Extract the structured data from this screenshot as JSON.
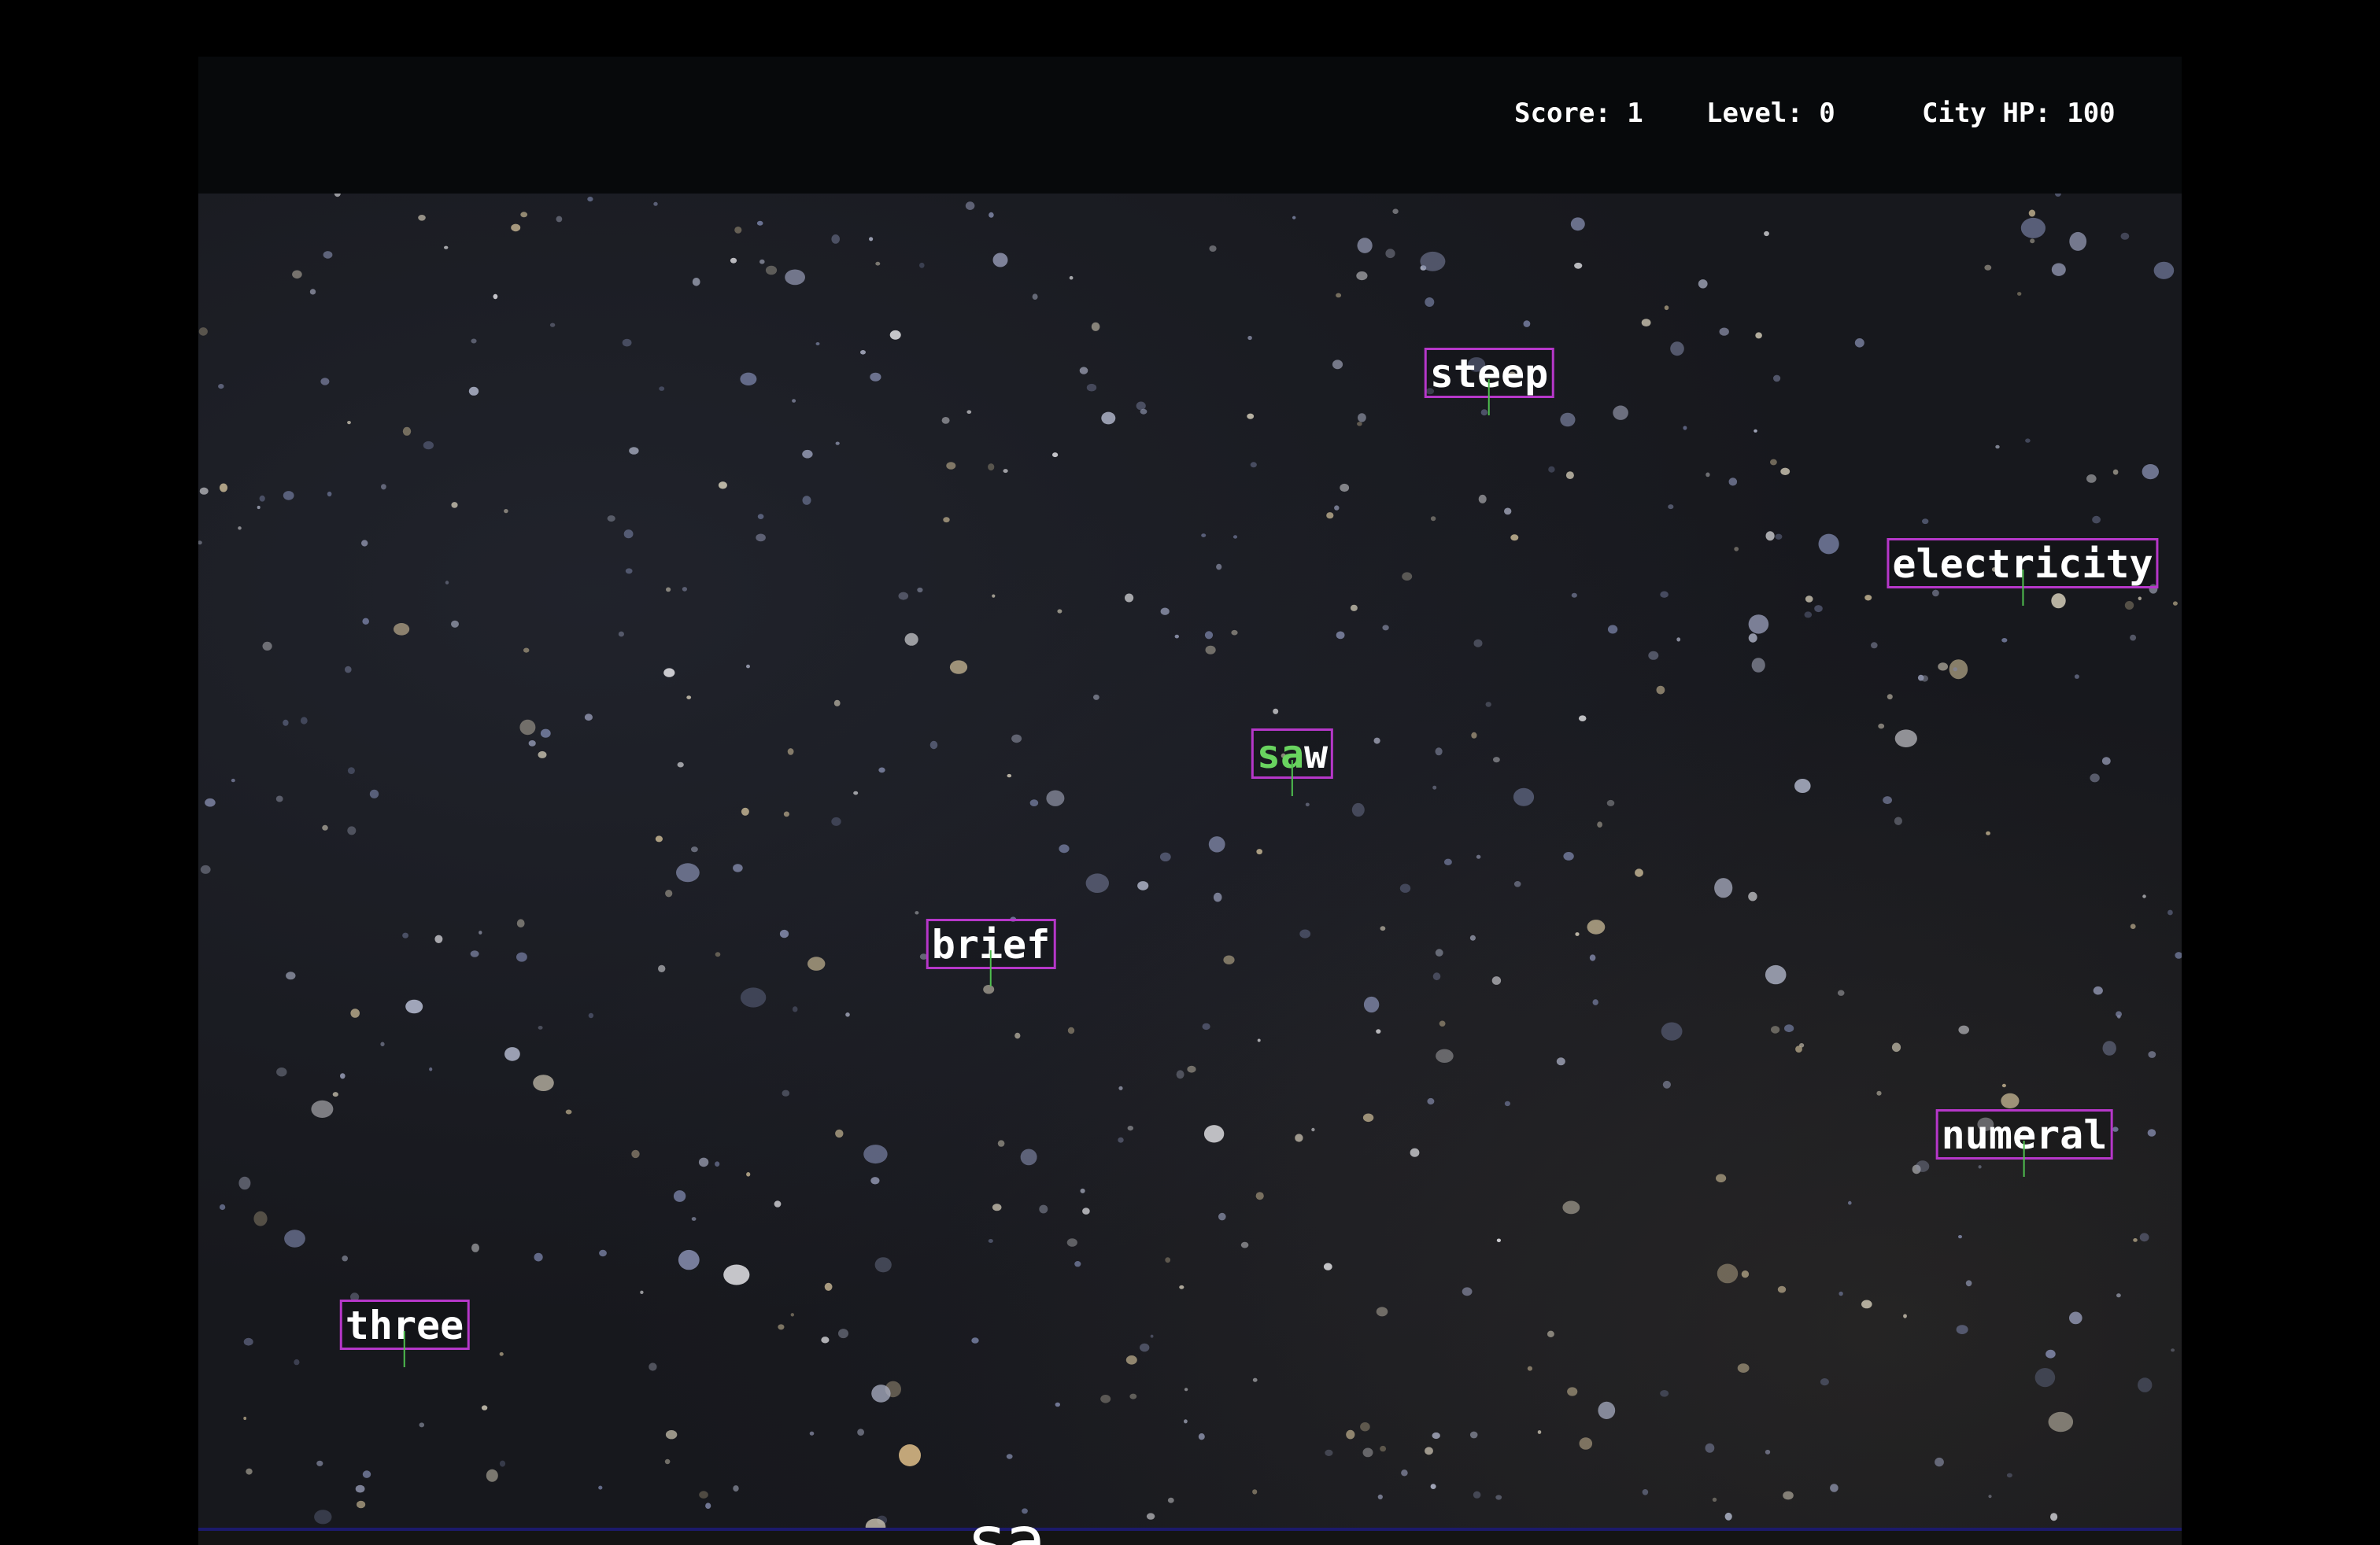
{
  "hud": {
    "score_label": "Score: 1",
    "level_label": "Level: 0",
    "city_hp_label": "City HP: 100"
  },
  "words": [
    {
      "id": "steep",
      "typed": "",
      "rest": "steep"
    },
    {
      "id": "electricity",
      "typed": "",
      "rest": "electricity"
    },
    {
      "id": "saw",
      "typed": "sa",
      "rest": "w"
    },
    {
      "id": "brief",
      "typed": "",
      "rest": "brief"
    },
    {
      "id": "numeral",
      "typed": "",
      "rest": "numeral"
    },
    {
      "id": "three",
      "typed": "",
      "rest": "three"
    }
  ],
  "input": {
    "value": "sa"
  },
  "colors": {
    "word_border": "#b637c9",
    "typed_letters": "#69d35f",
    "stem": "#4fbf4f",
    "input_bar_border": "#1c1a6b"
  }
}
